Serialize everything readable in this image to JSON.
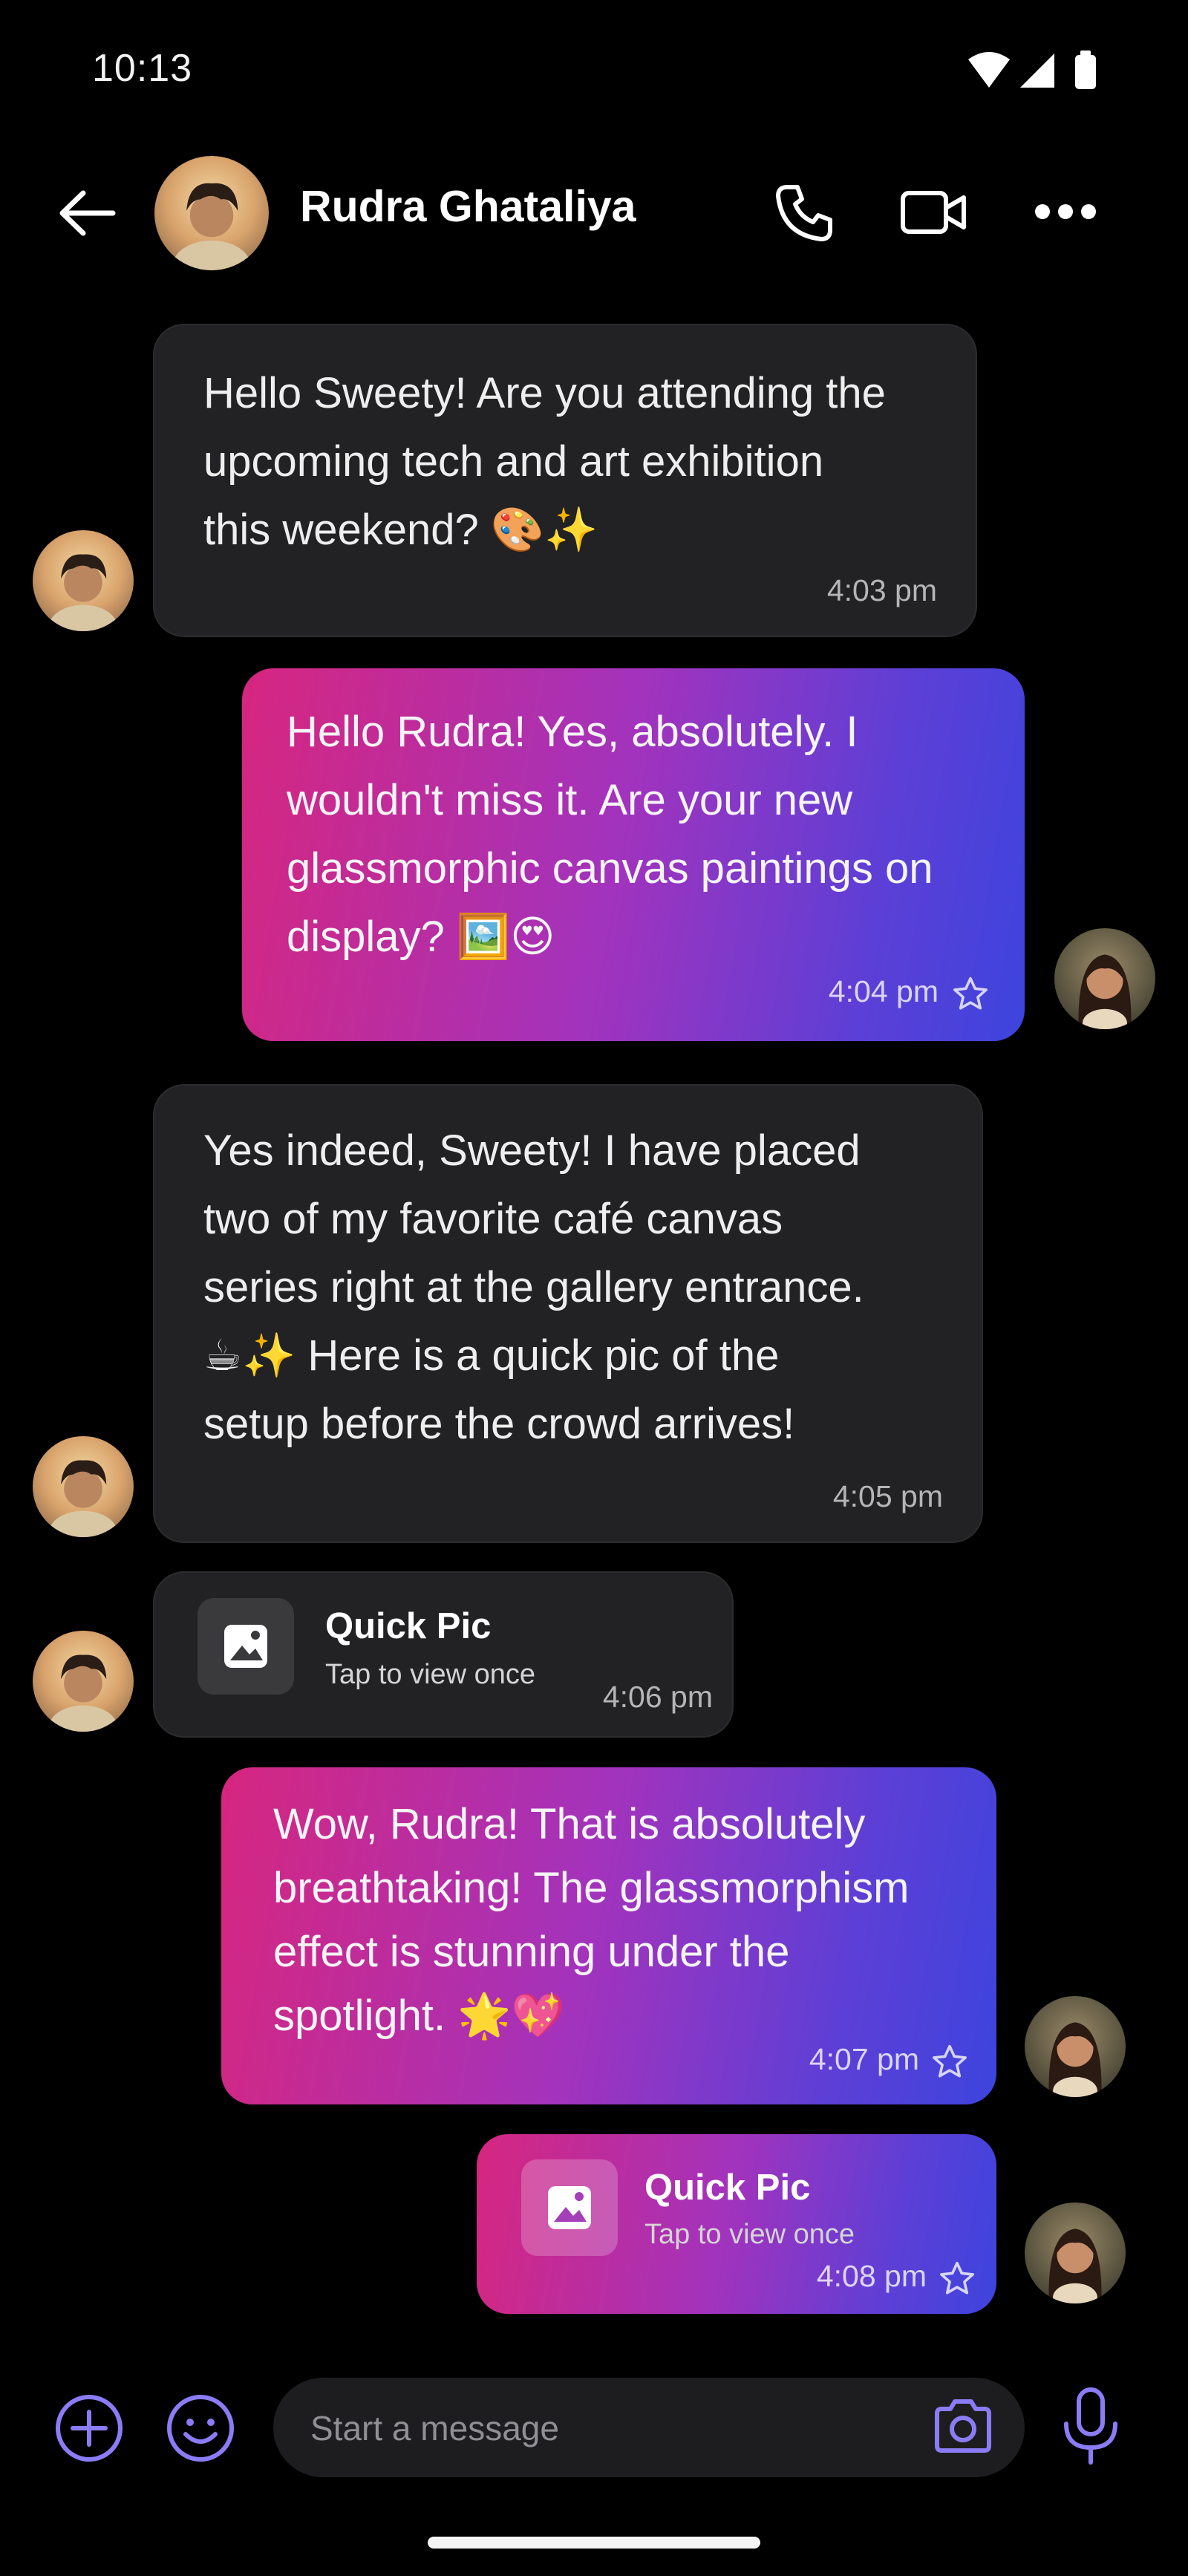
{
  "status_bar": {
    "time": "10:13",
    "icons": [
      "wifi-icon",
      "signal-icon",
      "battery-icon"
    ]
  },
  "header": {
    "contact_name": "Rudra Ghataliya",
    "actions": [
      "back-arrow-icon",
      "phone-icon",
      "video-camera-icon",
      "more-icon"
    ]
  },
  "colors": {
    "background": "#000000",
    "incoming_bubble": "#222224",
    "outgoing_gradient_start": "#d6267f",
    "outgoing_gradient_end": "#3d44de",
    "accent": "#8b7cf6"
  },
  "messages": [
    {
      "direction": "incoming",
      "type": "text",
      "text": "Hello Sweety! Are you attending the\nupcoming tech and art exhibition\nthis weekend? 🎨✨",
      "time": "4:03 pm"
    },
    {
      "direction": "outgoing",
      "type": "text",
      "text": "Hello Rudra! Yes, absolutely. I\nwouldn't miss it. Are your new\nglassmorphic canvas paintings on\ndisplay? 🖼️😍",
      "time": "4:04 pm",
      "starred": false
    },
    {
      "direction": "incoming",
      "type": "text",
      "text": "Yes indeed, Sweety! I have placed\ntwo of my favorite café canvas\nseries right at the gallery entrance.\n☕✨ Here is a quick pic of the\nsetup before the crowd arrives!",
      "time": "4:05 pm"
    },
    {
      "direction": "incoming",
      "type": "quick_pic",
      "title": "Quick Pic",
      "subtitle": "Tap to view once",
      "time": "4:06 pm"
    },
    {
      "direction": "outgoing",
      "type": "text",
      "text": "Wow, Rudra! That is absolutely\nbreathtaking! The glassmorphism\neffect is stunning under the\nspotlight. 🌟💖",
      "time": "4:07 pm",
      "starred": false
    },
    {
      "direction": "outgoing",
      "type": "quick_pic",
      "title": "Quick Pic",
      "subtitle": "Tap to view once",
      "time": "4:08 pm",
      "starred": false
    }
  ],
  "composer": {
    "placeholder": "Start a message",
    "icons": [
      "add-icon",
      "emoji-icon",
      "camera-icon",
      "microphone-icon"
    ]
  }
}
